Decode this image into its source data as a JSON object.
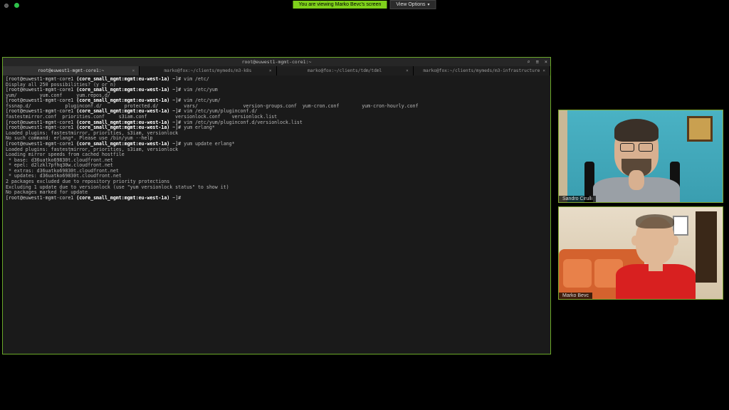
{
  "banner": {
    "message": "You are viewing Marko Bevc's screen",
    "options_label": "View Options"
  },
  "terminal": {
    "title": "root@euwest1-mgmt-core1:~",
    "tabs": [
      {
        "label": "root@euwest1-mgmt-core1:~",
        "active": true
      },
      {
        "label": "marko@fox:~/clients/mymeds/m3-k8s",
        "active": false
      },
      {
        "label": "marko@fox:~/clients/tdm/tdml",
        "active": false
      },
      {
        "label": "marko@fox:~/clients/mymeds/m3-infrastructure",
        "active": false
      }
    ],
    "prompt_user": "[root@euwest1-mgmt-core1 ",
    "prompt_context": "(core_small_mgmt:mgmt:eu-west-1a)",
    "prompt_suffix": " ~]# ",
    "lines": [
      {
        "cmd": "vim /etc/"
      },
      {
        "plain": "Display all 250 possibilities? (y or n)"
      },
      {
        "cmd": "vim /etc/yum"
      },
      {
        "plain": "yum/        yum.conf     yum.repos.d/"
      },
      {
        "cmd": "vim /etc/yum/"
      },
      {
        "plain": "fssnap.d/            pluginconf.d/        protected.d/         vars/                version-groups.conf  yum-cron.conf        yum-cron-hourly.conf"
      },
      {
        "cmd": "vim /etc/yum/pluginconf.d/"
      },
      {
        "plain": "fastestmirror.conf  priorities.conf     s3iam.conf          versionlock.conf    versionlock.list"
      },
      {
        "cmd": "vim /etc/yum/pluginconf.d/versionlock.list"
      },
      {
        "cmd": "yum erlang*"
      },
      {
        "plain": "Loaded plugins: fastestmirror, priorities, s3iam, versionlock"
      },
      {
        "plain": "No such command: erlang*. Please use /bin/yum --help"
      },
      {
        "cmd": "yum update erlang*"
      },
      {
        "plain": "Loaded plugins: fastestmirror, priorities, s3iam, versionlock"
      },
      {
        "plain": "Loading mirror speeds from cached hostfile"
      },
      {
        "plain": " * base: d36uatko69830t.cloudfront.net"
      },
      {
        "plain": " * epel: d2lzkl7pfhq30w.cloudfront.net"
      },
      {
        "plain": " * extras: d36uatko69830t.cloudfront.net"
      },
      {
        "plain": " * updates: d36uatko69830t.cloudfront.net"
      },
      {
        "plain": "2 packages excluded due to repository priority protections"
      },
      {
        "plain": "Excluding 1 update due to versionlock (use \"yum versionlock status\" to show it)"
      },
      {
        "plain": "No packages marked for update"
      },
      {
        "cmd": ""
      }
    ]
  },
  "cameras": {
    "top_name": "Sandro Cirulli",
    "bottom_name": "Marko Bevc"
  }
}
